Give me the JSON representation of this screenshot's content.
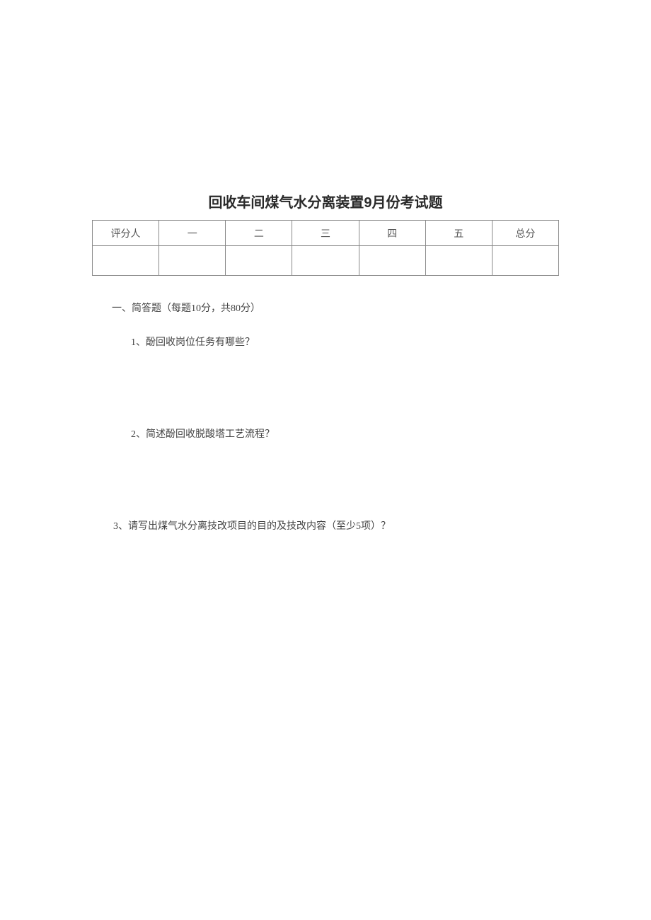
{
  "title": "回收车间煤气水分离装置9月份考试题",
  "table": {
    "headers": [
      "评分人",
      "一",
      "二",
      "三",
      "四",
      "五",
      "总分"
    ]
  },
  "section": {
    "heading": "一、简答题（每题10分，共80分）"
  },
  "questions": {
    "q1": "1、酚回收岗位任务有哪些？",
    "q2": "2、简述酚回收脱酸塔工艺流程？",
    "q3": "3、请写出煤气水分离技改项目的目的及技改内容（至少5项）？"
  }
}
